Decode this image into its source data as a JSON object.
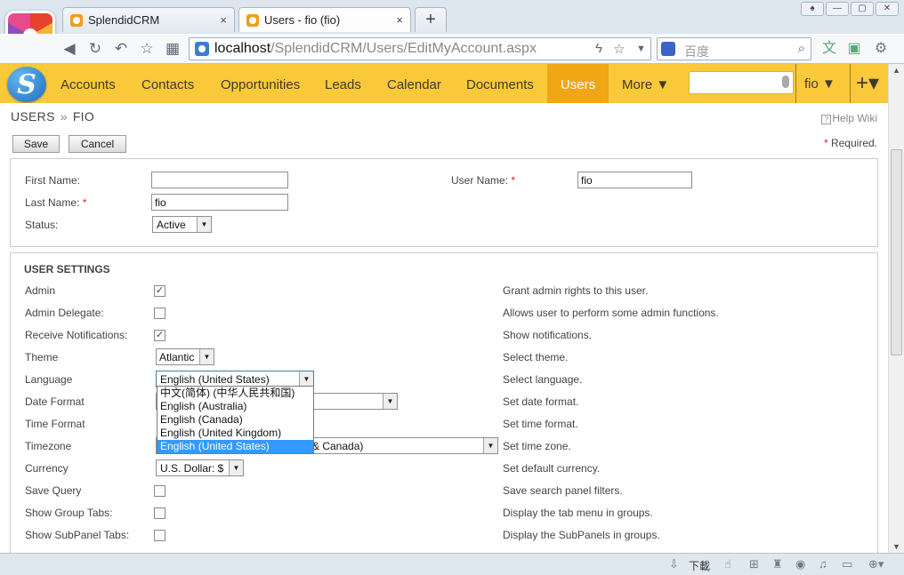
{
  "browser": {
    "tabs": [
      {
        "label": "SplendidCRM",
        "close": "×"
      },
      {
        "label": "Users - fio (fio)",
        "close": "×"
      }
    ],
    "new_tab": "+",
    "url_host": "localhost",
    "url_path": "/SplendidCRM/Users/EditMyAccount.aspx",
    "search_placeholder": "百度",
    "status_download": "下載"
  },
  "app": {
    "logo_letter": "S",
    "nav": [
      "Accounts",
      "Contacts",
      "Opportunities",
      "Leads",
      "Calendar",
      "Documents",
      "Users"
    ],
    "more": "More ▼",
    "active": "Users",
    "user_menu": "fio ▼",
    "plus_menu": "+▾"
  },
  "page": {
    "breadcrumb_module": "USERS",
    "breadcrumb_sep": "»",
    "breadcrumb_record": "FIO",
    "help": "Help Wiki",
    "save": "Save",
    "cancel": "Cancel",
    "required_star": "*",
    "required_note": "Required."
  },
  "form": {
    "first_name_label": "First Name:",
    "first_name_value": "",
    "last_name_label": "Last Name:",
    "last_name_value": "fio",
    "status_label": "Status:",
    "status_value": "Active",
    "user_name_label": "User Name:",
    "user_name_value": "fio"
  },
  "settings": {
    "title": "USER SETTINGS",
    "rows": [
      {
        "label": "Admin",
        "desc": "Grant admin rights to this user."
      },
      {
        "label": "Admin Delegate:",
        "desc": "Allows user to perform some admin functions."
      },
      {
        "label": "Receive Notifications:",
        "desc": "Show notifications."
      },
      {
        "label": "Theme",
        "value": "Atlantic",
        "desc": "Select theme."
      },
      {
        "label": "Language",
        "value": "English (United States)",
        "desc": "Select language."
      },
      {
        "label": "Date Format",
        "desc": "Set date format."
      },
      {
        "label": "Time Format",
        "desc": "Set time format."
      },
      {
        "label": "Timezone",
        "value": "& Canada)",
        "desc": "Set time zone."
      },
      {
        "label": "Currency",
        "value": "U.S. Dollar: $",
        "desc": "Set default currency."
      },
      {
        "label": "Save Query",
        "desc": "Save search panel filters."
      },
      {
        "label": "Show Group Tabs:",
        "desc": "Display the tab menu in groups."
      },
      {
        "label": "Show SubPanel Tabs:",
        "desc": "Display the SubPanels in groups."
      }
    ],
    "checked": {
      "admin": true,
      "admin_delegate": false,
      "receive_notifications": true,
      "save_query": false,
      "show_group_tabs": false,
      "show_subpanel_tabs": false
    },
    "language_options": [
      "中文(简体) (中华人民共和国)",
      "English (Australia)",
      "English (Canada)",
      "English (United Kingdom)",
      "English (United States)"
    ],
    "language_highlighted_index": 4
  },
  "colors": {
    "nav_bg": "#f9c93a",
    "nav_active": "#f0a615",
    "required": "#dd2222",
    "highlight": "#3399ff"
  }
}
